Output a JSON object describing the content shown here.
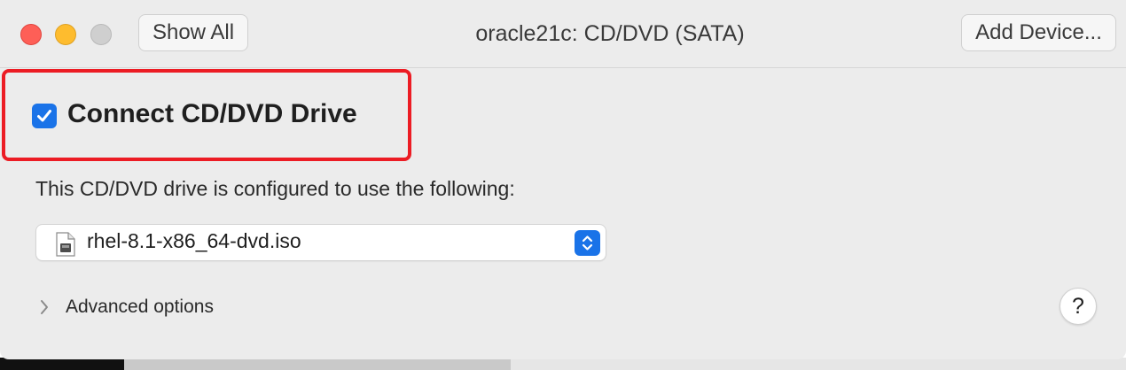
{
  "window": {
    "title": "oracle21c: CD/DVD (SATA)"
  },
  "toolbar": {
    "show_all_label": "Show All",
    "add_device_label": "Add Device..."
  },
  "connect": {
    "label": "Connect CD/DVD Drive",
    "checked": true
  },
  "config": {
    "description": "This CD/DVD drive is configured to use the following:",
    "selected_file": "rhel-8.1-x86_64-dvd.iso"
  },
  "advanced": {
    "label": "Advanced options"
  },
  "help": {
    "label": "?"
  },
  "colors": {
    "accent": "#1a73e8",
    "highlight": "#ec1c24",
    "close": "#fe5f57",
    "minimize": "#febc2e",
    "maximize_disabled": "#cfcfcf"
  },
  "icons": {
    "close": "close-icon",
    "minimize": "minimize-icon",
    "maximize": "maximize-icon",
    "checkbox": "checkmark-icon",
    "file": "disk-image-file-icon",
    "stepper": "up-down-chevron-icon",
    "disclosure": "chevron-right-icon"
  }
}
